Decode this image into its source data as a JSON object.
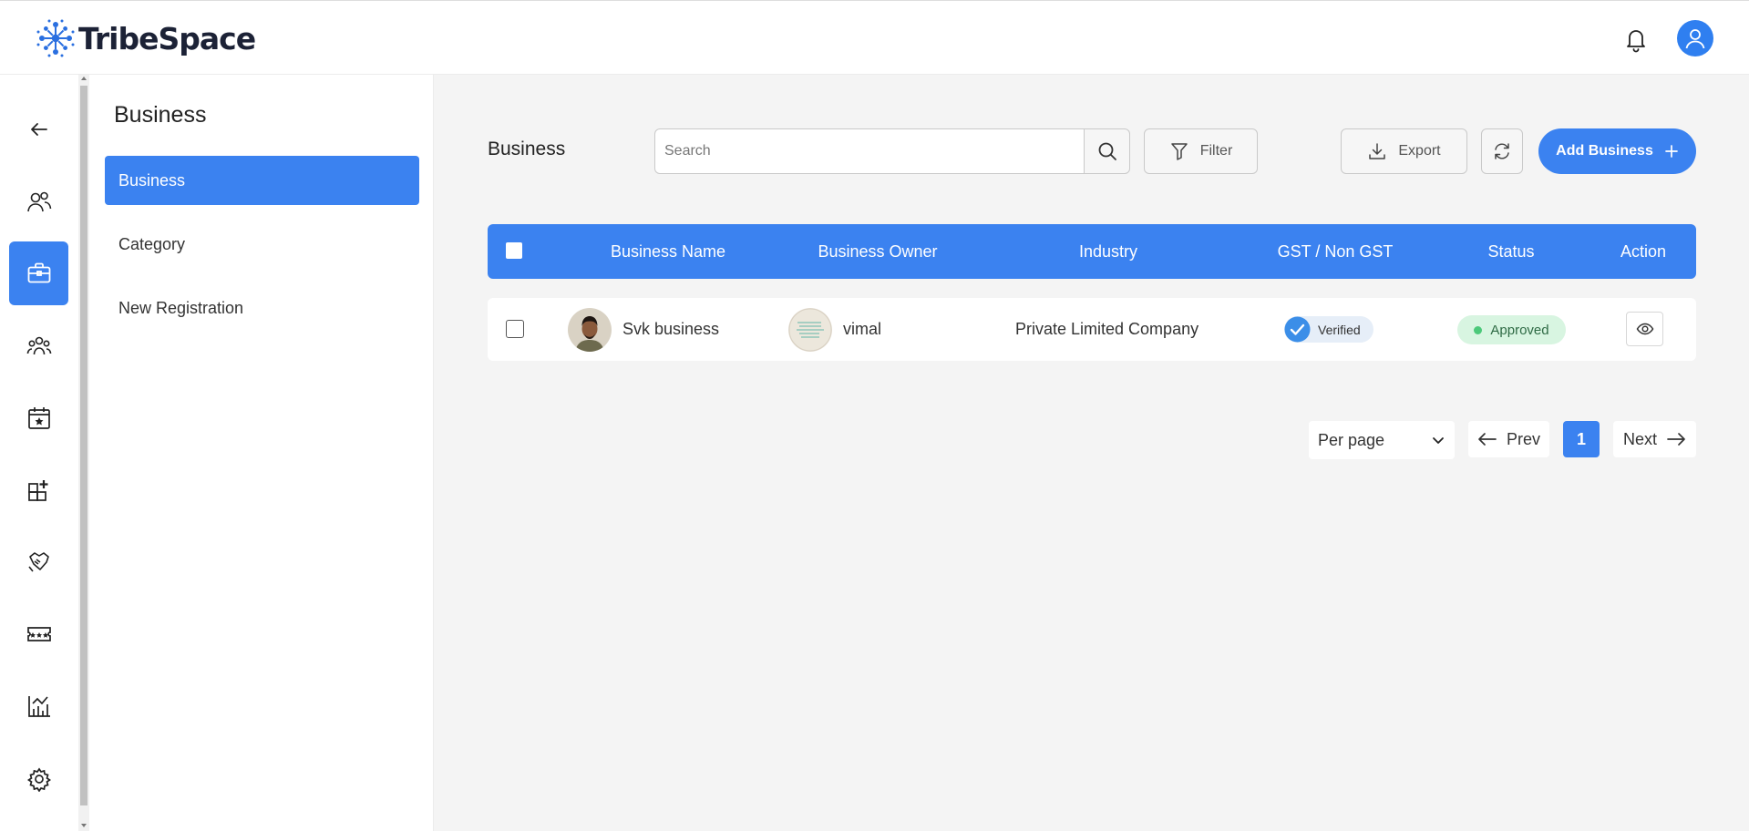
{
  "brand": {
    "name": "TribeSpace"
  },
  "header": {
    "bell_icon": "bell-icon",
    "profile_icon": "user-icon"
  },
  "rail": {
    "items": [
      {
        "icon": "arrow-left-icon"
      },
      {
        "icon": "users-icon"
      },
      {
        "icon": "briefcase-icon",
        "active": true
      },
      {
        "icon": "group-icon"
      },
      {
        "icon": "calendar-star-icon"
      },
      {
        "icon": "blocks-plus-icon"
      },
      {
        "icon": "handshake-icon"
      },
      {
        "icon": "ticket-icon"
      },
      {
        "icon": "bar-chart-icon"
      },
      {
        "icon": "gear-icon"
      }
    ]
  },
  "submenu": {
    "title": "Business",
    "items": [
      {
        "label": "Business",
        "active": true
      },
      {
        "label": "Category"
      },
      {
        "label": "New Registration"
      }
    ]
  },
  "main": {
    "title": "Business",
    "search": {
      "placeholder": "Search",
      "value": ""
    },
    "filter_label": "Filter",
    "export_label": "Export",
    "add_label": "Add Business"
  },
  "table": {
    "columns": [
      "Business Name",
      "Business Owner",
      "Industry",
      "GST / Non GST",
      "Status",
      "Action"
    ],
    "rows": [
      {
        "business_name": "Svk business",
        "business_owner": "vimal",
        "industry": "Private Limited Company",
        "gst": "Verified",
        "status": "Approved"
      }
    ]
  },
  "pagination": {
    "per_page_label": "Per page",
    "prev": "Prev",
    "page": "1",
    "next": "Next"
  },
  "colors": {
    "accent": "#3b82f0",
    "approved_bg": "#d8f5e1",
    "approved_dot": "#4cc97a",
    "background": "#f4f4f4"
  }
}
